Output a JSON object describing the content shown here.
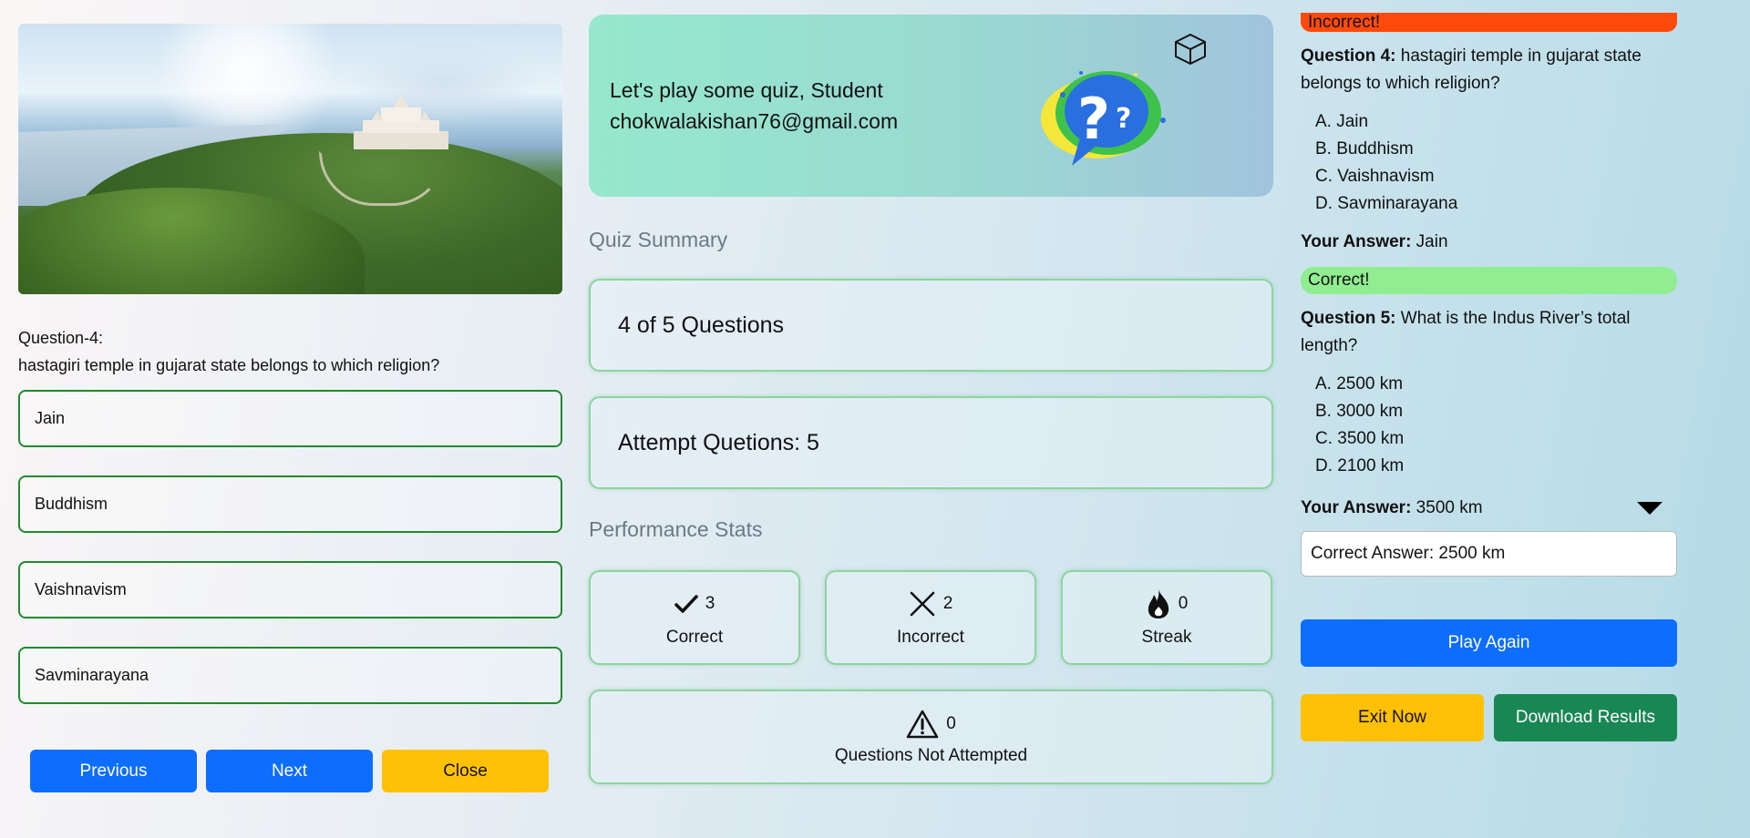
{
  "left": {
    "question_number": "Question-4:",
    "question_text": "hastagiri temple in gujarat state belongs to which religion?",
    "options": [
      "Jain",
      "Buddhism",
      "Vaishnavism",
      "Savminarayana"
    ],
    "buttons": {
      "previous": "Previous",
      "next": "Next",
      "close": "Close"
    }
  },
  "banner": {
    "greeting": "Let's play some quiz, Student",
    "email": "chokwalakishan76@gmail.com"
  },
  "summary": {
    "title": "Quiz Summary",
    "progress": "4 of 5 Questions",
    "attempted": "Attempt Quetions: 5"
  },
  "performance": {
    "title": "Performance Stats",
    "correct": {
      "count": "3",
      "label": "Correct"
    },
    "incorrect": {
      "count": "2",
      "label": "Incorrect"
    },
    "streak": {
      "count": "0",
      "label": "Streak"
    },
    "not_attempted": {
      "count": "0",
      "label": "Questions Not Attempted"
    }
  },
  "review": {
    "top_status": "Incorrect!",
    "q4": {
      "label": "Question 4:",
      "text": " hastagiri temple in gujarat state belongs to which religion?",
      "choices": [
        "A. Jain",
        "B. Buddhism",
        "C. Vaishnavism",
        "D. Savminarayana"
      ],
      "answer_label": "Your Answer:",
      "answer_value": " Jain",
      "status": "Correct!"
    },
    "q5": {
      "label": "Question 5:",
      "text": " What is the Indus River’s total length?",
      "choices": [
        "A. 2500 km",
        "B. 3000 km",
        "C. 3500 km",
        "D. 2100 km"
      ],
      "answer_label": "Your Answer:",
      "answer_value": " 3500 km",
      "correct_answer": "Correct Answer: 2500 km"
    },
    "buttons": {
      "play_again": "Play Again",
      "exit": "Exit Now",
      "download": "Download Results"
    }
  },
  "colors": {
    "primary": "#0d6efd",
    "warning": "#ffc107",
    "success": "#198754",
    "incorrect_pill": "#ff4a0b",
    "correct_pill": "#90ee90",
    "option_border": "#1f8a2e"
  }
}
